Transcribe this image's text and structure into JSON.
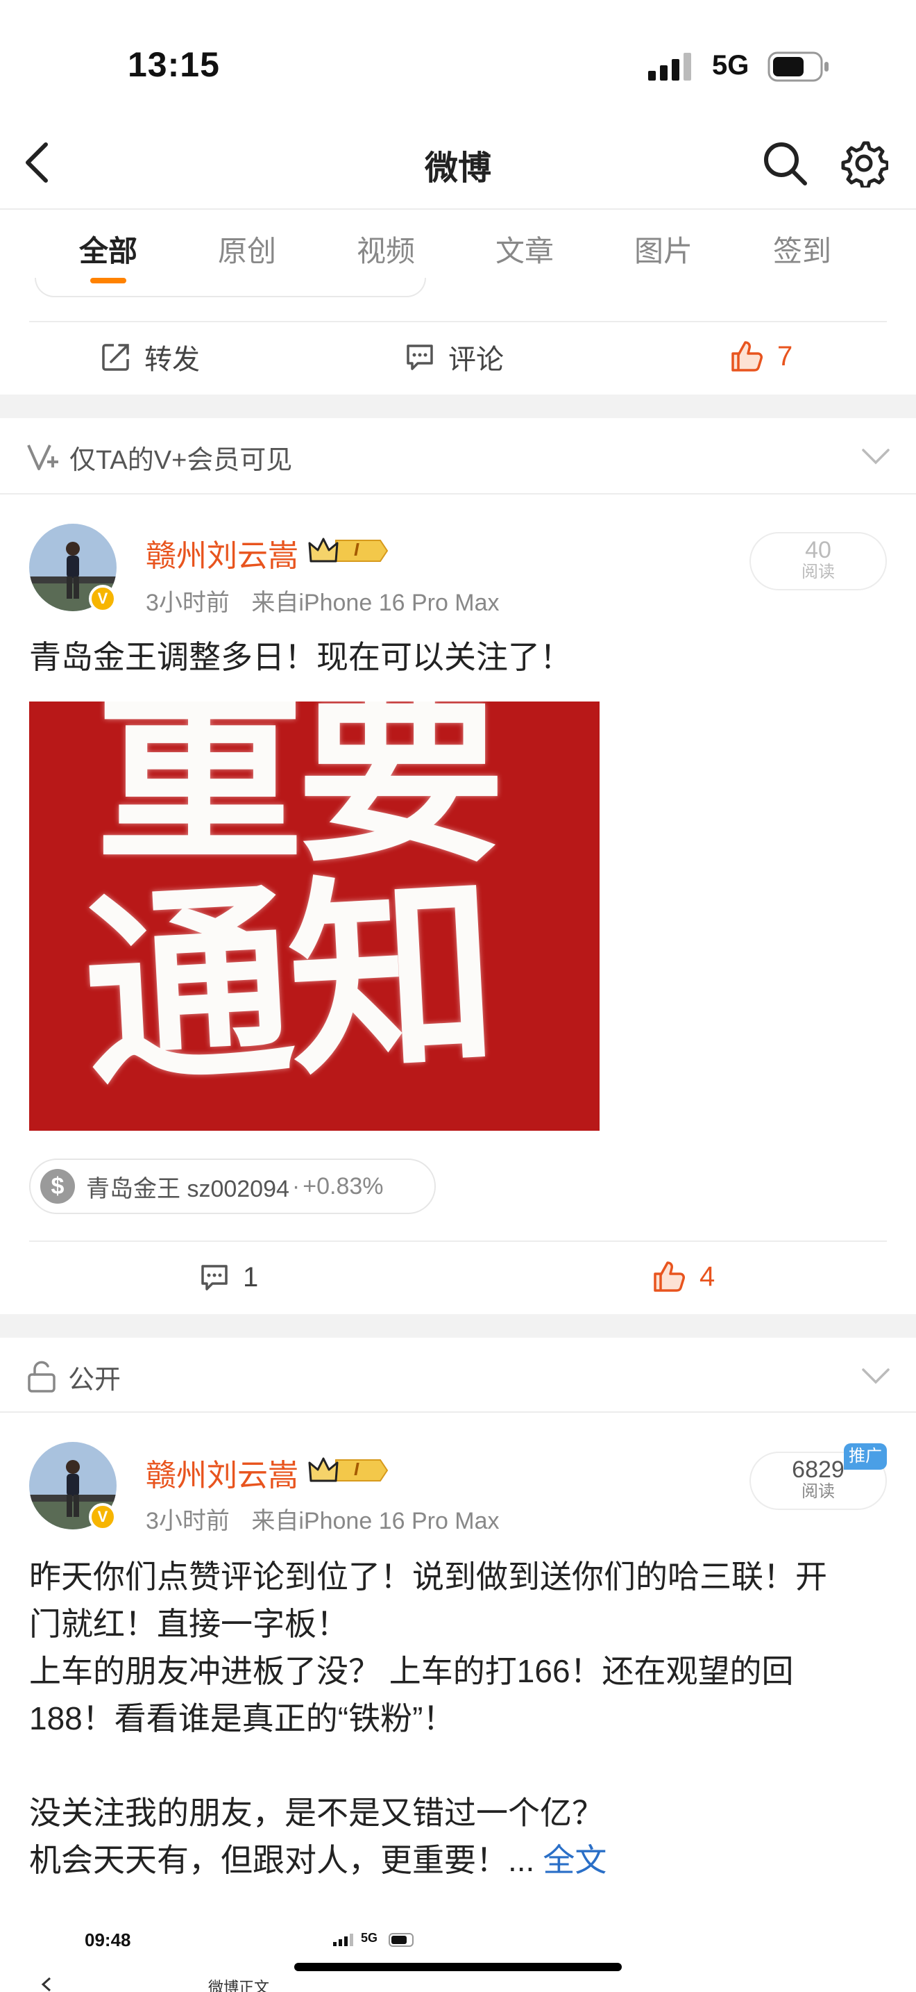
{
  "status_bar": {
    "time": "13:15",
    "network": "5G"
  },
  "nav": {
    "title": "微博"
  },
  "tabs": [
    {
      "label": "全部",
      "active": true
    },
    {
      "label": "原创"
    },
    {
      "label": "视频"
    },
    {
      "label": "文章"
    },
    {
      "label": "图片"
    },
    {
      "label": "签到"
    }
  ],
  "prev_post_actions": {
    "repost": "转发",
    "comment": "评论",
    "like_count": "7"
  },
  "section1": {
    "visibility": "仅TA的V+会员可见"
  },
  "post1": {
    "username": "赣州刘云嵩",
    "level_badge": "I",
    "meta_time": "3小时前",
    "meta_source": "来自iPhone 16 Pro Max",
    "reads": "40",
    "reads_label": "阅读",
    "text": "青岛金王调整多日！现在可以关注了！",
    "image_line1": "重要",
    "image_line2": "通知",
    "stock_name": "青岛金王 sz002094",
    "stock_change": "+0.83%",
    "comment_count": "1",
    "like_count": "4"
  },
  "section2": {
    "visibility": "公开"
  },
  "post2": {
    "username": "赣州刘云嵩",
    "level_badge": "I",
    "meta_time": "3小时前",
    "meta_source": "来自iPhone 16 Pro Max",
    "reads": "6829",
    "reads_label": "阅读",
    "promo": "推广",
    "lines": [
      "昨天你们点赞评论到位了！说到做到送你们的哈三联！开",
      "门就红！直接一字板！",
      "上车的朋友冲进板了没？ 上车的打166！还在观望的回",
      "188！看看谁是真正的“铁粉”！",
      "",
      "没关注我的朋友，是不是又错过一个亿？",
      "机会天天有，但跟对人，更重要！..."
    ],
    "full_text_link": "全文"
  },
  "embedded_preview": {
    "time": "09:48",
    "network": "5G",
    "title": "微博正文"
  },
  "colors": {
    "accent_orange": "#ff8200",
    "username": "#e8541e",
    "link_blue": "#2a6fc7",
    "notice_red": "#b81818"
  }
}
